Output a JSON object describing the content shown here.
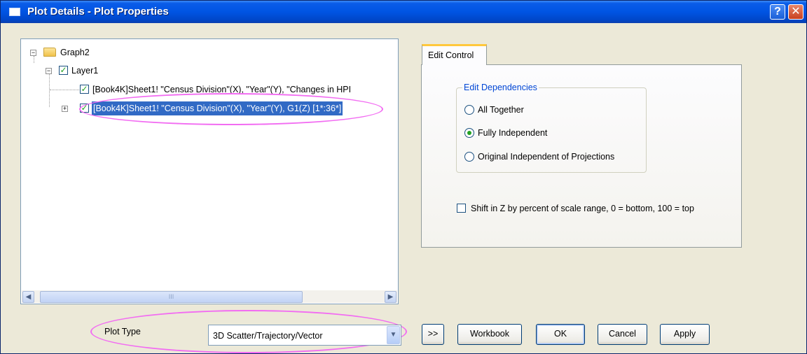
{
  "window": {
    "title": "Plot Details - Plot Properties",
    "help_glyph": "?",
    "close_glyph": "✕"
  },
  "tree": {
    "root": {
      "label": "Graph2",
      "expander": "−"
    },
    "layer": {
      "label": "Layer1",
      "expander": "−",
      "check": "✓"
    },
    "plots": [
      {
        "label": "[Book4K]Sheet1! \"Census Division\"(X), \"Year\"(Y), \"Changes in HPI",
        "check": "✓"
      },
      {
        "label": "[Book4K]Sheet1! \"Census Division\"(X), \"Year\"(Y), G1(Z) [1*:36*]",
        "check": "✓",
        "expander": "+",
        "selected": true
      }
    ],
    "scroll_left": "◀",
    "scroll_right": "▶",
    "scroll_grip": "III"
  },
  "tab": {
    "label": "Edit Control"
  },
  "edit_dependencies": {
    "legend": "Edit Dependencies",
    "options": [
      "All Together",
      "Fully Independent",
      "Original Independent of Projections"
    ],
    "selected": "Fully Independent"
  },
  "shift_checkbox": {
    "label": "Shift in Z by percent of scale range, 0 = bottom, 100 = top",
    "checked": false
  },
  "plot_type": {
    "label": "Plot Type",
    "value": "3D Scatter/Trajectory/Vector",
    "dropdown_glyph": "▼"
  },
  "buttons": {
    "more": ">>",
    "workbook": "Workbook",
    "ok": "OK",
    "cancel": "Cancel",
    "apply": "Apply"
  },
  "colors": {
    "title_bar": "#0054e3",
    "selection": "#316ac5",
    "highlight": "#f26cf2",
    "dialog_bg": "#ece9d8"
  }
}
